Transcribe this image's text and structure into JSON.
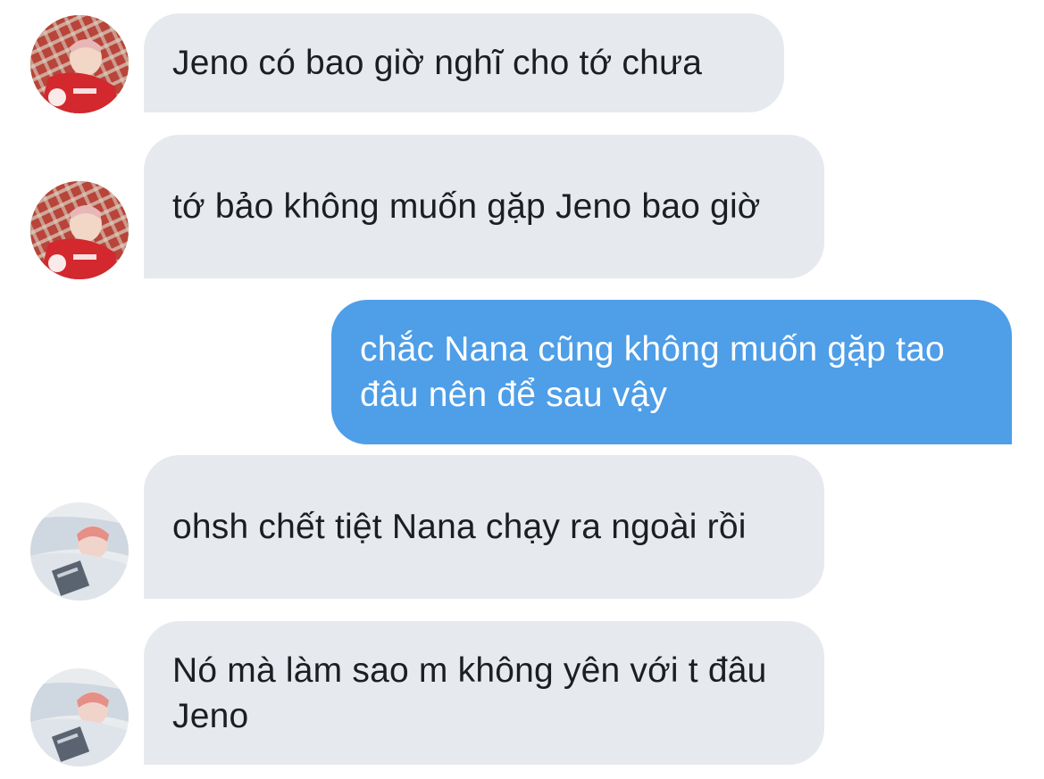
{
  "colors": {
    "incoming_bubble": "#e6e9ee",
    "outgoing_bubble": "#4e9ee8",
    "incoming_text": "#1c1e21",
    "outgoing_text": "#ffffff"
  },
  "messages": [
    {
      "direction": "incoming",
      "avatar": "avatar-red-picnic-photo",
      "text": "Jeno có bao giờ nghĩ cho tớ chưa"
    },
    {
      "direction": "incoming",
      "avatar": "avatar-red-picnic-photo",
      "text": "tớ bảo không muốn gặp Jeno bao giờ"
    },
    {
      "direction": "outgoing",
      "text": "chắc Nana cũng không muốn gặp tao đâu nên để sau vậy"
    },
    {
      "direction": "incoming",
      "avatar": "avatar-bed-magazine-photo",
      "text": "ohsh chết tiệt Nana chạy ra ngoài rồi"
    },
    {
      "direction": "incoming",
      "avatar": "avatar-bed-magazine-photo",
      "text": "Nó mà làm sao m không yên với t đâu Jeno"
    }
  ]
}
